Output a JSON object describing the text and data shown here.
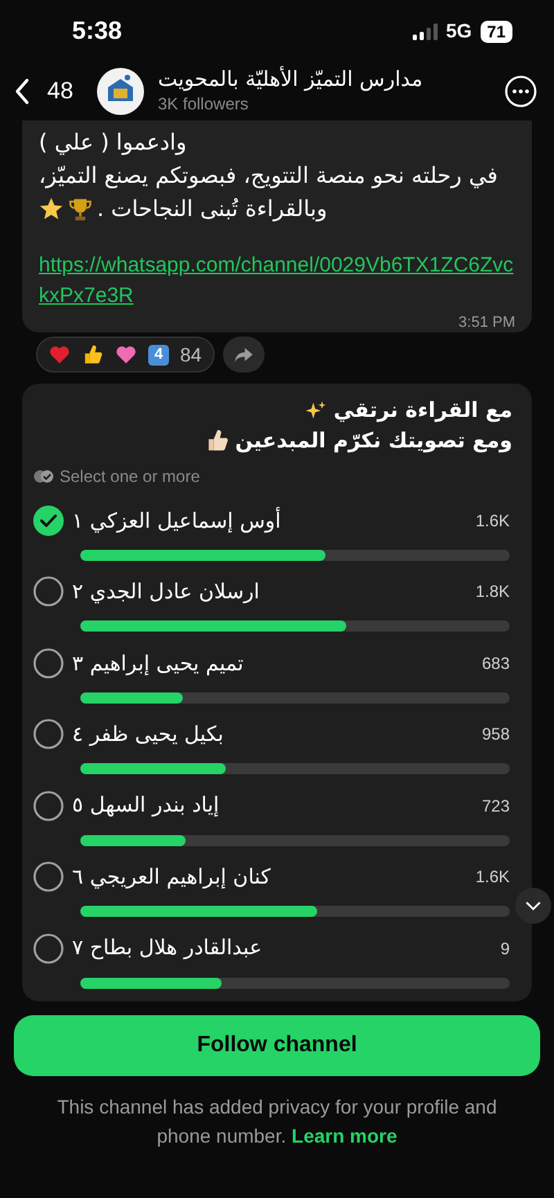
{
  "status_bar": {
    "time": "5:38",
    "network": "5G",
    "battery": "71"
  },
  "header": {
    "back_count": "48",
    "channel_name": "مدارس التميّز الأهليّة بالمحويت",
    "followers": "3K followers"
  },
  "message": {
    "lines": [
      "وادعموا ( علي )",
      "في رحلته نحو منصة التتويج، فبصوتكم يصنع التميّز،",
      "وبالقراءة تُبنى النجاحات ."
    ],
    "link": "https://whatsapp.com/channel/0029Vb6TX1ZC6ZvckxPx7e3R",
    "time": "3:51 PM",
    "reactions": {
      "keycap": "4",
      "count": "84"
    }
  },
  "poll": {
    "title_lines": [
      "مع القراءة نرتقي",
      "ومع تصويتك نكرّم المبدعين"
    ],
    "hint": "Select one or more",
    "options": [
      {
        "label": "أوس إسماعيل العزكي ١",
        "count": "1.6K",
        "level": 0.57,
        "selected": true
      },
      {
        "label": "ارسلان عادل الجدي ٢",
        "count": "1.8K",
        "level": 0.62,
        "selected": false
      },
      {
        "label": "تميم يحيى إبراهيم ٣",
        "count": "683",
        "level": 0.24,
        "selected": false
      },
      {
        "label": "بكيل يحيى ظفر ٤",
        "count": "958",
        "level": 0.34,
        "selected": false
      },
      {
        "label": "إياد بندر السهل ٥",
        "count": "723",
        "level": 0.245,
        "selected": false
      },
      {
        "label": "كنان إبراهيم العريجي ٦",
        "count": "1.6K",
        "level": 0.55,
        "selected": false
      },
      {
        "label": "عبدالقادر هلال بطاح ٧",
        "count": "9",
        "level": 0.33,
        "selected": false
      }
    ]
  },
  "follow_button": "Follow channel",
  "privacy": {
    "text": "This channel has added privacy for your profile and phone number.",
    "link": "Learn more"
  }
}
